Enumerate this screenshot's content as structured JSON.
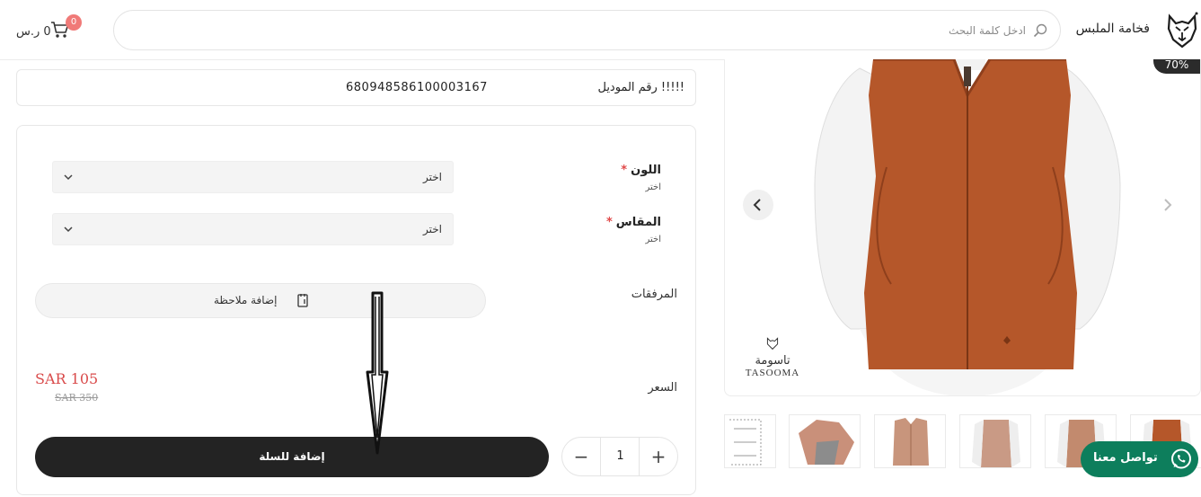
{
  "header": {
    "brand": "فخامة الملبس",
    "search_placeholder": "ادخل كلمة البحث",
    "cart_total": "0 ر.س",
    "cart_count": "0"
  },
  "product": {
    "model_label": "!!!!! رقم الموديل",
    "model_number": "680948586100003167",
    "discount_badge": "70%",
    "watermark_ar": "تاسومة",
    "watermark_en": "TASOOMA",
    "thumbnail_count": 6
  },
  "options": {
    "color": {
      "label": "اللون",
      "required_mark": "*",
      "sub": "اختر",
      "value": "اختر"
    },
    "size": {
      "label": "المقاس",
      "required_mark": "*",
      "sub": "اختر",
      "value": "اختر"
    },
    "attachments_label": "المرفقات",
    "add_note": "إضافة ملاحظة"
  },
  "pricing": {
    "label": "السعر",
    "current": "SAR 105",
    "original": "SAR 350"
  },
  "cart_form": {
    "quantity": "1",
    "plus": "+",
    "minus": "−",
    "add_to_cart": "إضافة للسلة"
  },
  "contact": {
    "whatsapp_label": "تواصل معنا"
  },
  "colors": {
    "vest": "#b5572a",
    "dark_button": "#232323",
    "whatsapp": "#0d7e5c",
    "price": "#d94b4b"
  }
}
